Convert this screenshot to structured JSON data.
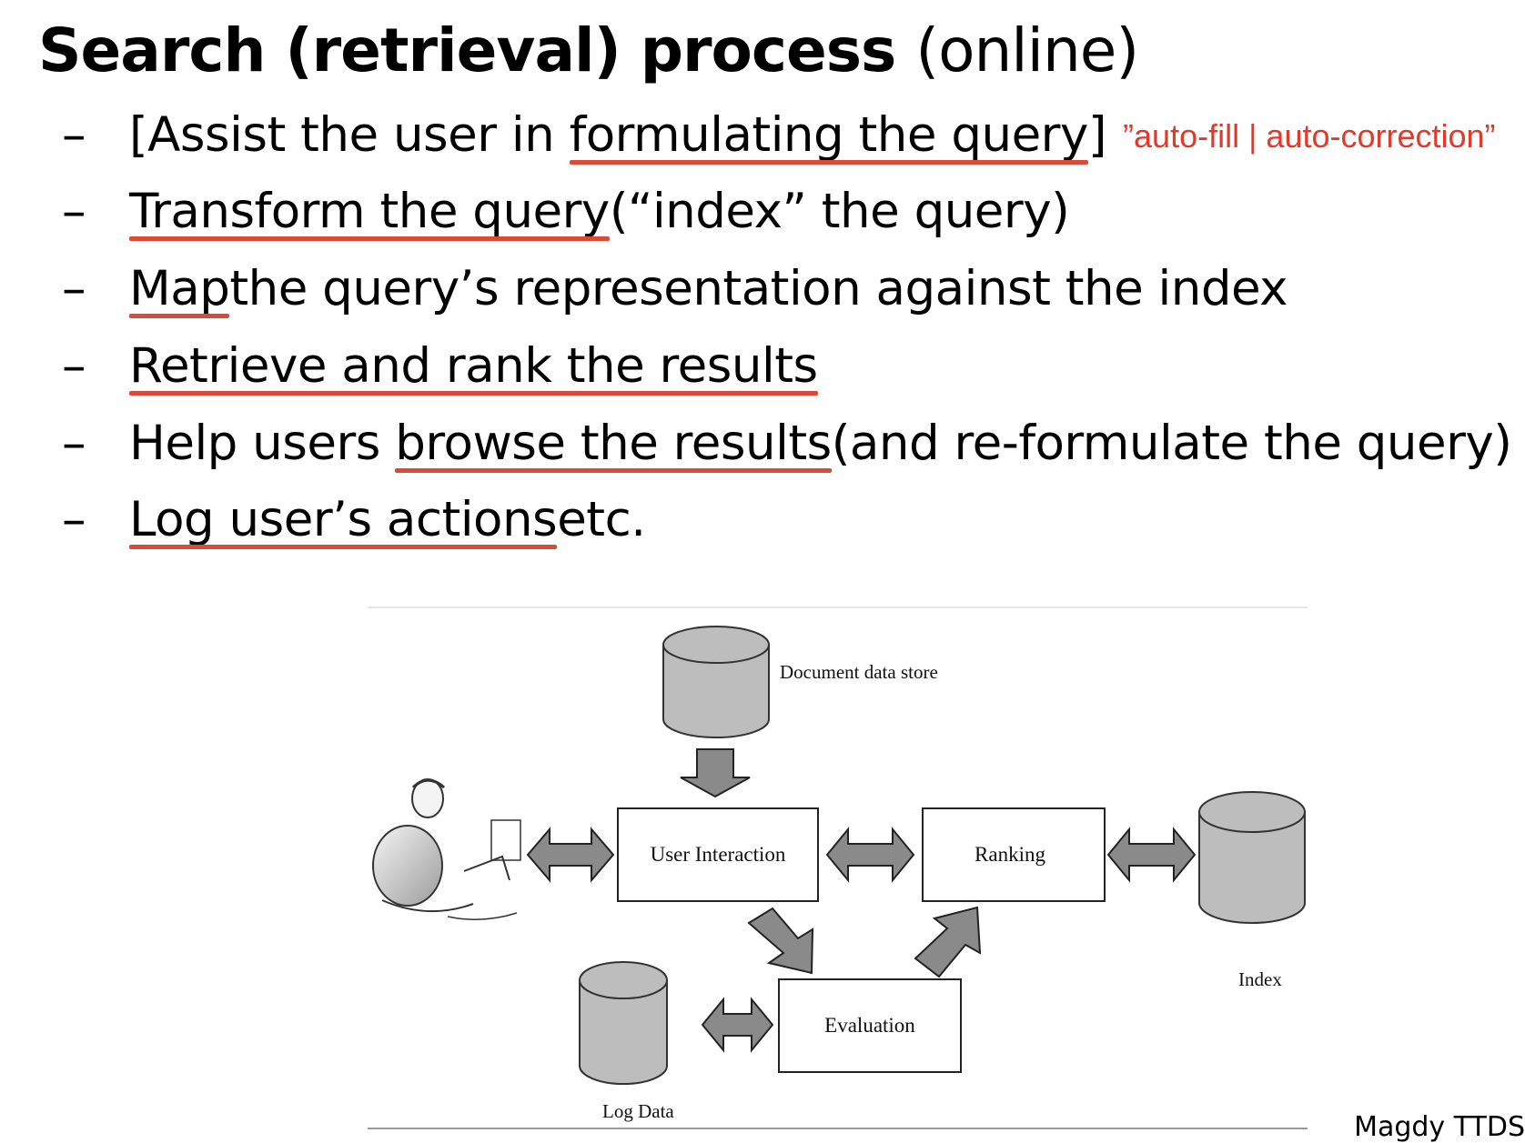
{
  "slide": {
    "title_bold": "Search (retrieval) process",
    "title_rest": "(online)",
    "dash": "–",
    "bullets": [
      {
        "pre": "[Assist the user in ",
        "underlined": "formulating the query",
        "post": "]",
        "note": "”auto-fill | auto-correction”"
      },
      {
        "pre": "",
        "underlined": "Transform the query ",
        "post": "(“index” the query)"
      },
      {
        "pre": "",
        "underlined": "Map ",
        "post": "the query’s representation against the index"
      },
      {
        "pre": "",
        "underlined": "Retrieve and rank the results",
        "post": ""
      },
      {
        "pre": "Help users ",
        "underlined": "browse the results ",
        "post": "(and re-formulate the query)"
      },
      {
        "pre": "",
        "underlined": "Log user’s actions ",
        "post": "etc."
      }
    ],
    "footer": "Magdy TTDS"
  },
  "diagram": {
    "nodes": {
      "user_interaction": "User Interaction",
      "ranking": "Ranking",
      "evaluation": "Evaluation"
    },
    "stores": {
      "document_store": "Document data store",
      "index": "Index",
      "log_data": "Log Data"
    },
    "colors": {
      "fill_gray": "#bdbdbd",
      "arrow_gray": "#8a8a8a",
      "underline": "#d94a38",
      "note": "#e03a2b"
    }
  }
}
